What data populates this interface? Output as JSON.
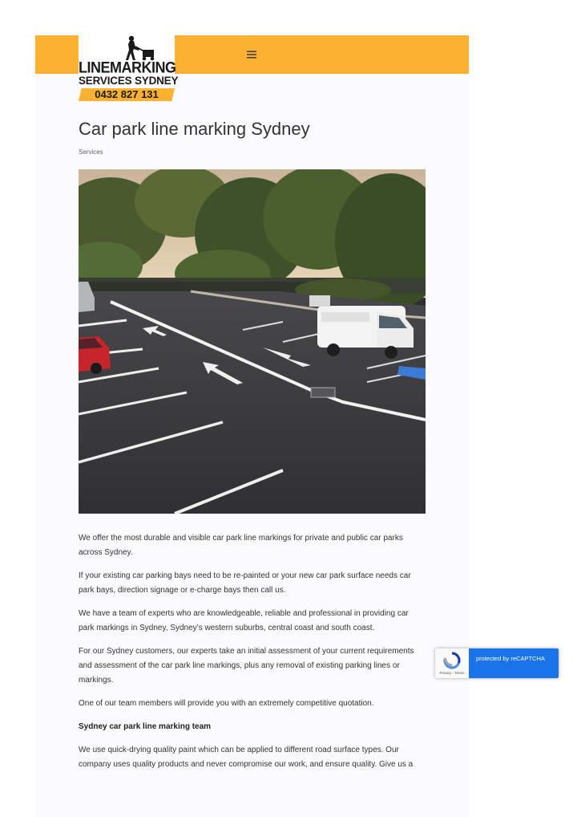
{
  "header": {
    "logo": {
      "line1": "LINEMARKING",
      "line2": "SERVICES SYDNEY",
      "phone": "0432 827 131"
    },
    "menu_icon": "hamburger-menu-icon",
    "accent_color": "#fdb133"
  },
  "article": {
    "title": "Car park line marking Sydney",
    "category": "Services",
    "hero_image": "car-park-line-marking-photo",
    "paragraphs": [
      "We offer the most durable and visible car park line markings for private and public car parks across Sydney.",
      "If your existing car parking bays need to be re-painted or your new car park surface needs car park bays, direction signage or e-charge bays then call us.",
      "We have a team of experts who are knowledgeable, reliable and professional in providing car park markings in Sydney, Sydney’s western suburbs, central coast and south coast.",
      "For our Sydney customers, our experts take an initial assessment of your current requirements and assessment of the car park line markings, plus any removal of existing parking lines or markings.",
      "One of our team members will provide you with an extremely competitive quotation."
    ],
    "subheading": "Sydney car park line marking team",
    "paragraph_after_heading": "We use quick-drying quality paint which can be applied to different road surface types. Our company uses quality products and never compromise our work, and ensure quality. Give us a"
  },
  "recaptcha": {
    "text": "protected by reCAPTCHA",
    "links": "Privacy - Terms",
    "color": "#1a73e8"
  }
}
